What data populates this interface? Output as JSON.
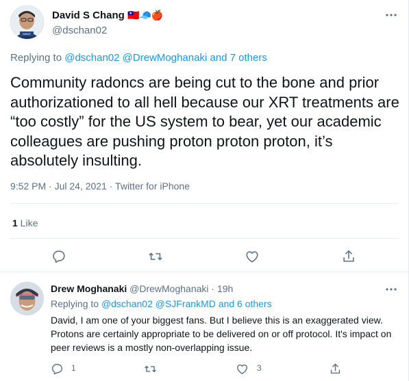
{
  "tweet": {
    "author_name": "David S Chang",
    "name_emoji": "🇹🇼🧢🍎",
    "handle": "@dschan02",
    "replying_prefix": "Replying to ",
    "replying_link": "@dschan02 @DrewMoghanaki and 7 others",
    "text": "Community radoncs are being cut to the bone and prior authorizationed to all hell because our XRT treatments are “too costly” for the US system to bear, yet our academic colleagues are pushing proton proton proton, it’s absolutely insulting.",
    "timestamp": "9:52 PM · Jul 24, 2021 · Twitter for iPhone",
    "like_count": "1",
    "like_label": " Like"
  },
  "reply": {
    "author_name": "Drew Moghanaki",
    "handle_time": "@DrewMoghanaki · 19h",
    "replying_prefix": "Replying to ",
    "replying_link": "@dschan02 @SJFrankMD and 6 others",
    "text": "David, I am one of your biggest fans. But I believe this is an exaggerated view. Protons are certainly appropriate to be delivered on or off protocol. It's impact on peer reviews is a mostly non-overlapping issue.",
    "reply_count": "1",
    "like_count": "3"
  },
  "icons": [
    "more-icon",
    "reply-icon",
    "retweet-icon",
    "like-icon",
    "share-icon"
  ],
  "colors": {
    "link": "#1b95e0",
    "secondary": "#5b7083",
    "border": "#e6ecf0"
  }
}
